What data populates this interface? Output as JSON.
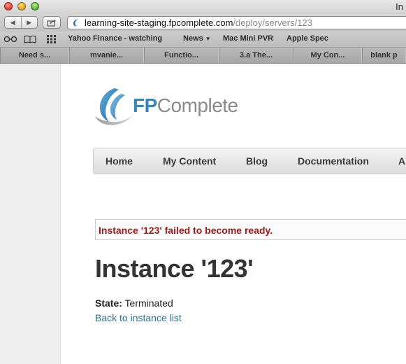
{
  "window": {
    "title_fragment": "In"
  },
  "toolbar": {
    "back_glyph": "◀",
    "forward_glyph": "▶",
    "url_host": "learning-site-staging.fpcomplete.com",
    "url_path": "/deploy/servers/123"
  },
  "bookmarks": {
    "items": [
      {
        "label": "Yahoo Finance - watching"
      },
      {
        "label": "News"
      },
      {
        "label": "Mac Mini PVR"
      },
      {
        "label": "Apple Spec"
      }
    ]
  },
  "tabs": [
    {
      "label": "Need s..."
    },
    {
      "label": "mvanie..."
    },
    {
      "label": "Functio..."
    },
    {
      "label": "3.a The..."
    },
    {
      "label": "My Con..."
    },
    {
      "label": "blank p"
    }
  ],
  "logo": {
    "fp": "FP",
    "complete": "Complete"
  },
  "nav": {
    "items": [
      {
        "label": "Home"
      },
      {
        "label": "My Content"
      },
      {
        "label": "Blog"
      },
      {
        "label": "Documentation"
      },
      {
        "label": "A"
      }
    ]
  },
  "alert": {
    "message": "Instance '123' failed to become ready."
  },
  "page": {
    "title": "Instance '123'",
    "state_label": "State:",
    "state_value": "Terminated",
    "back_link": "Back to instance list"
  },
  "colors": {
    "alert_text": "#9b1c1c",
    "link": "#2e6f8e",
    "logo_blue": "#3a86b8",
    "logo_gray": "#8a8a8a"
  }
}
